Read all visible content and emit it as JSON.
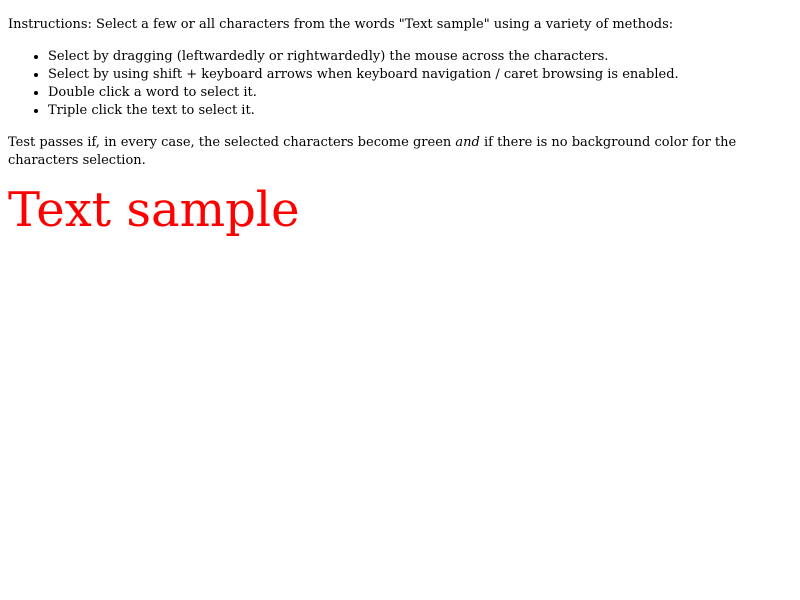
{
  "instructions": "Instructions: Select a few or all characters from the words \"Text sample\" using a variety of methods:",
  "methods": [
    "Select by dragging (leftwardedly or rightwardedly) the mouse across the characters.",
    "Select by using shift + keyboard arrows when keyboard navigation / caret browsing is enabled.",
    "Double click a word to select it.",
    "Triple click the text to select it."
  ],
  "pass_criteria": {
    "before": "Test passes if, in every case, the selected characters become green ",
    "emphasis": "and",
    "after": " if there is no background color for the characters selection."
  },
  "sample_text": "Text sample",
  "colors": {
    "sample_text": "#ff0000",
    "selection_text": "#008000"
  }
}
